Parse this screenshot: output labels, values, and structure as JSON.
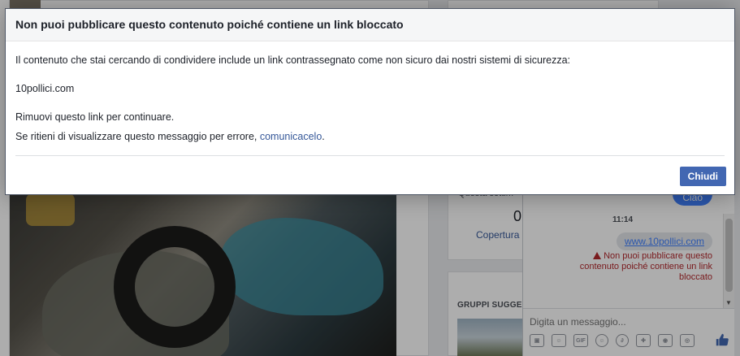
{
  "modal": {
    "title": "Non puoi pubblicare questo contenuto poiché contiene un link bloccato",
    "body_line1": "Il contenuto che stai cercando di condividere include un link contrassegnato come non sicuro dai nostri sistemi di sicurezza:",
    "blocked_domain": "10pollici.com",
    "body_line2": "Rimuovi questo link per continuare.",
    "body_line3_prefix": "Se ritieni di visualizzare questo messaggio per errore, ",
    "report_link": "comunicacelo",
    "body_line3_suffix": ".",
    "close_label": "Chiudi"
  },
  "right_sidebar": {
    "partial_text": "Questa settim",
    "stat_value": "0",
    "stat_label": "Copertura",
    "groups_title": "GRUPPI SUGGER"
  },
  "chat": {
    "top_bubble": "Ciao",
    "time": "11:14",
    "link_bubble": "www.10pollici.com",
    "error_message": "Non puoi pubblicare questo contenuto poiché contiene un link bloccato",
    "input_placeholder": "Digita un messaggio...",
    "tools": [
      "photo-icon",
      "sticker-icon",
      "gif-icon",
      "emoji-icon",
      "attachment-icon",
      "game-icon",
      "camera-icon",
      "instagram-icon"
    ],
    "gif_label": "GIF"
  },
  "colors": {
    "primary": "#4267b2",
    "link": "#365899",
    "error": "#b3282d",
    "chat_blue": "#4080ff"
  }
}
